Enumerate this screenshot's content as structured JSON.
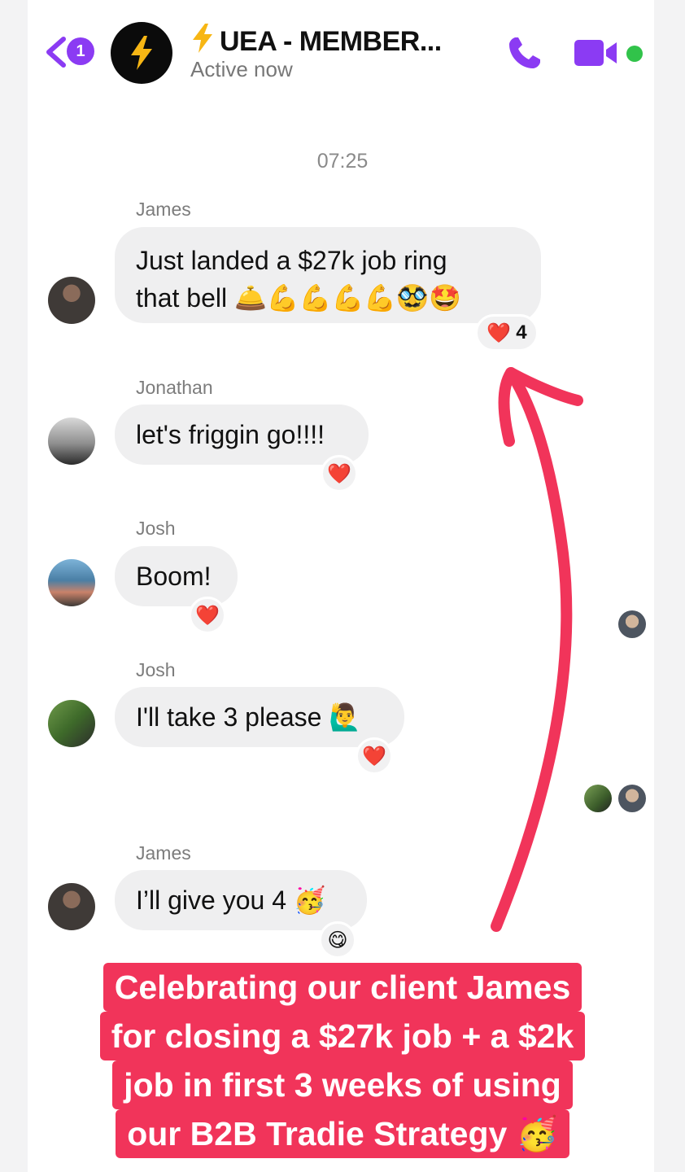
{
  "header": {
    "back_badge": "1",
    "title": "UEA - MEMBER...",
    "status": "Active now"
  },
  "conversation": {
    "timestamp": "07:25",
    "messages": [
      {
        "sender": "James",
        "text_line1": "Just landed a $27k job ring",
        "text_line2": "that bell",
        "emojis": "🛎️💪💪💪💪🥸🤩",
        "reaction": "❤️",
        "reaction_count": "4"
      },
      {
        "sender": "Jonathan",
        "text": "let's friggin go!!!!",
        "reaction": "❤️"
      },
      {
        "sender": "Josh",
        "text": "Boom!",
        "reaction": "❤️"
      },
      {
        "sender": "Josh",
        "text": "I'll take 3 please",
        "emoji": "🙋‍♂️",
        "reaction": "❤️"
      },
      {
        "sender": "James",
        "text": "I’ll give you 4",
        "emoji": "🥳",
        "reaction": "😋"
      }
    ]
  },
  "caption": {
    "line1": "Celebrating our client James",
    "line2": "for closing a $27k job + a $2k",
    "line3": "job in first 3 weeks of using",
    "line4": "our B2B Tradie Strategy",
    "emoji": "🥳"
  },
  "colors": {
    "accent": "#8b3bf3",
    "caption_bg": "#f1345a",
    "arrow": "#f1345a",
    "online": "#31c34a",
    "bubble": "#efeff0"
  },
  "icons": [
    "back-chevron-icon",
    "bolt-icon",
    "phone-icon",
    "video-camera-icon",
    "heart-icon"
  ]
}
